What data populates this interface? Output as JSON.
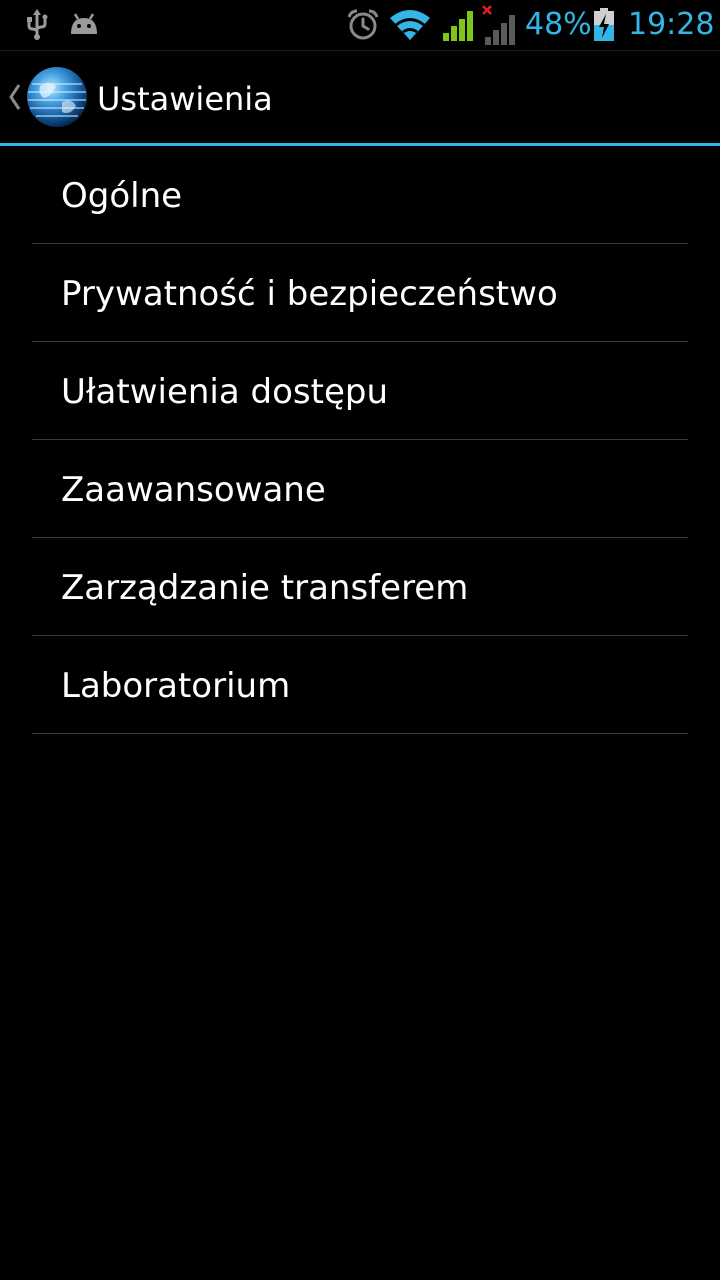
{
  "status_bar": {
    "battery_text": "48%",
    "time": "19:28",
    "accent_color": "#33b5e5",
    "signal_color": "#7fc61b",
    "icons": [
      "usb-icon",
      "android-icon",
      "alarm-icon",
      "wifi-icon",
      "signal-icon",
      "signal-no-data-icon",
      "battery-charging-icon"
    ]
  },
  "action_bar": {
    "title": "Ustawienia",
    "icon": "globe-app-icon",
    "divider_color": "#33b5e5"
  },
  "settings": {
    "items": [
      {
        "label": "Ogólne"
      },
      {
        "label": "Prywatność i bezpieczeństwo"
      },
      {
        "label": "Ułatwienia dostępu"
      },
      {
        "label": "Zaawansowane"
      },
      {
        "label": "Zarządzanie transferem"
      },
      {
        "label": "Laboratorium"
      }
    ]
  }
}
